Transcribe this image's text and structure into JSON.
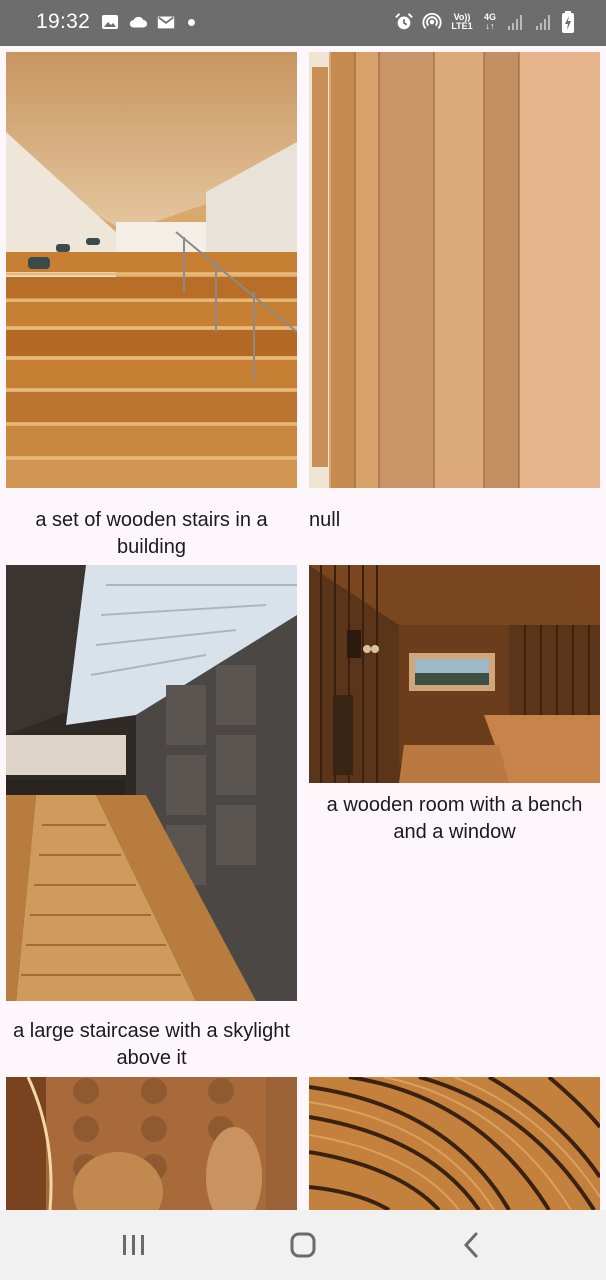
{
  "status_bar": {
    "time": "19:32",
    "left_icons": [
      "gallery-icon",
      "cloud-icon",
      "mail-icon",
      "notification-dot-icon"
    ],
    "right_icons": [
      "alarm-icon",
      "hotspot-icon",
      "volte-icon",
      "4g-lte-icon",
      "signal-icon",
      "signal-icon-2",
      "battery-charging-icon"
    ],
    "volte_label_top": "Vo))",
    "volte_label_bottom": "LTE1",
    "net_label_top": "4G",
    "net_label_bottom": "↓↑"
  },
  "grid": {
    "items": [
      {
        "caption": "a set of wooden stairs in a building",
        "image": "wooden-stairs-photo"
      },
      {
        "caption": "null",
        "image": "wooden-columns-photo"
      },
      {
        "caption": "a large staircase with a skylight above it",
        "image": "staircase-skylight-photo"
      },
      {
        "caption": "a wooden room with a bench and a window",
        "image": "sauna-room-photo"
      },
      {
        "caption": "",
        "image": "wooden-wall-ovals-photo"
      },
      {
        "caption": "",
        "image": "curved-wood-ceiling-photo"
      }
    ]
  },
  "nav_bar": {
    "buttons": [
      "recent-apps-icon",
      "home-icon",
      "back-icon"
    ]
  }
}
